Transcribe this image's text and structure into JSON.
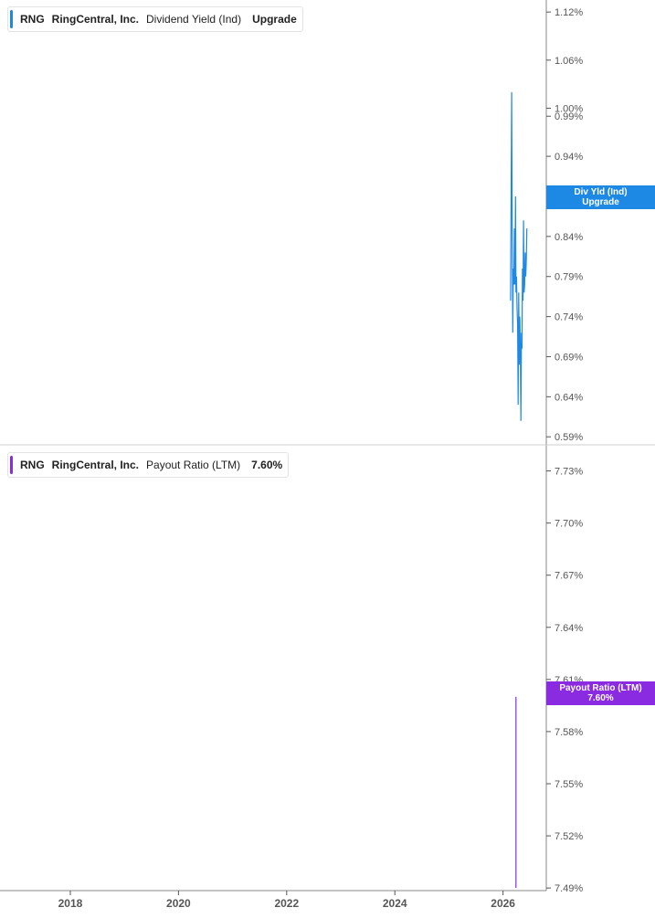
{
  "colors": {
    "yield": "#1e88e5",
    "payout": "#8a2be2",
    "axis": "#555555",
    "grid": "#d0d0d0"
  },
  "top_legend": {
    "ticker": "RNG",
    "company": "RingCentral, Inc.",
    "metric": "Dividend Yield (Ind)",
    "value": "Upgrade"
  },
  "bottom_legend": {
    "ticker": "RNG",
    "company": "RingCentral, Inc.",
    "metric": "Payout Ratio (LTM)",
    "value": "7.60%"
  },
  "top_badge": {
    "line1": "Div Yld (Ind)",
    "line2": "Upgrade"
  },
  "bottom_badge": {
    "line1": "Payout Ratio (LTM)",
    "line2": "7.60%"
  },
  "chart_data": [
    {
      "type": "line",
      "series": [
        {
          "name": "Dividend Yield (Ind)",
          "x": [
            2026.14,
            2026.16,
            2026.17,
            2026.18,
            2026.19,
            2026.2,
            2026.21,
            2026.22,
            2026.23,
            2026.24,
            2026.25,
            2026.26,
            2026.27,
            2026.28,
            2026.29,
            2026.3,
            2026.31,
            2026.32,
            2026.33,
            2026.34,
            2026.35,
            2026.36,
            2026.37,
            2026.38,
            2026.39,
            2026.4,
            2026.41,
            2026.42,
            2026.43,
            2026.44
          ],
          "values": [
            0.76,
            1.02,
            0.84,
            0.72,
            0.8,
            0.78,
            0.85,
            0.78,
            0.89,
            0.77,
            0.79,
            0.75,
            0.73,
            0.63,
            0.77,
            0.68,
            0.74,
            0.7,
            0.61,
            0.72,
            0.7,
            0.8,
            0.76,
            0.86,
            0.77,
            0.78,
            0.82,
            0.79,
            0.81,
            0.85
          ]
        }
      ],
      "y_ticks": [
        "1.12%",
        "1.06%",
        "1.00%",
        "0.99%",
        "0.94%",
        "0.89%",
        "0.84%",
        "0.79%",
        "0.74%",
        "0.69%",
        "0.64%",
        "0.59%"
      ],
      "y_tick_values": [
        1.12,
        1.06,
        1.0,
        0.99,
        0.94,
        0.89,
        0.84,
        0.79,
        0.74,
        0.69,
        0.64,
        0.59
      ],
      "ylim": [
        0.58,
        1.135
      ]
    },
    {
      "type": "line",
      "series": [
        {
          "name": "Payout Ratio (LTM)",
          "x": [
            2026.24,
            2026.24
          ],
          "values": [
            7.49,
            7.6
          ]
        }
      ],
      "y_ticks": [
        "7.73%",
        "7.70%",
        "7.67%",
        "7.64%",
        "7.61%",
        "7.58%",
        "7.55%",
        "7.52%",
        "7.49%"
      ],
      "y_tick_values": [
        7.73,
        7.7,
        7.67,
        7.64,
        7.61,
        7.58,
        7.55,
        7.52,
        7.49
      ],
      "ylim": [
        7.4885,
        7.745
      ]
    }
  ],
  "x_axis": {
    "ticks": [
      "2018",
      "2020",
      "2022",
      "2024",
      "2026"
    ],
    "tick_values": [
      2018,
      2020,
      2022,
      2024,
      2026
    ],
    "xlim": [
      2016.7,
      2026.8
    ]
  }
}
